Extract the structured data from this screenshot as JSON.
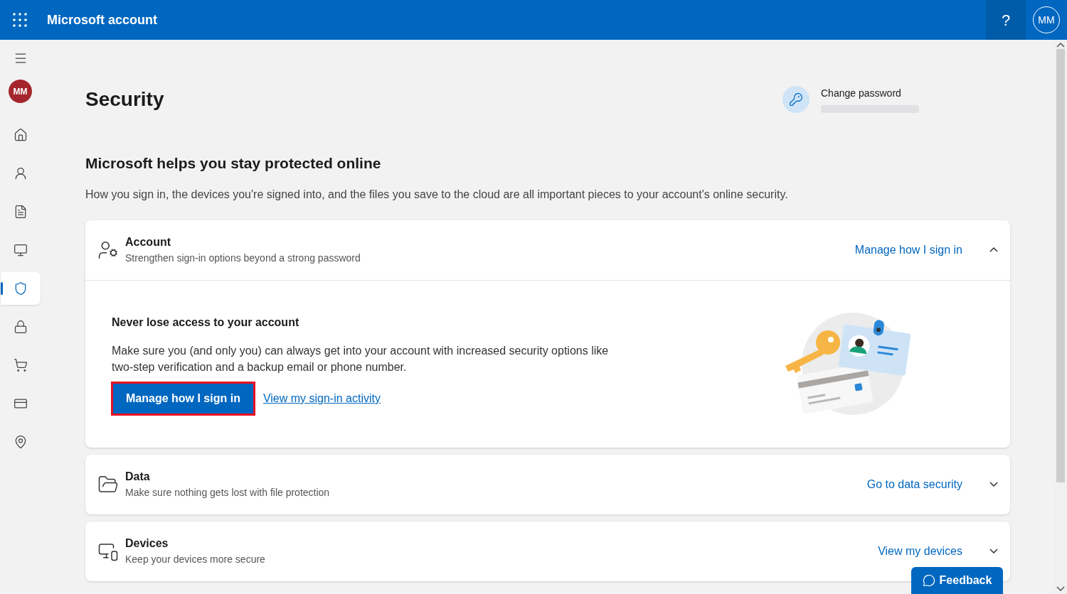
{
  "header": {
    "title": "Microsoft account",
    "help": "?",
    "avatar": "MM"
  },
  "sidebar": {
    "avatar": "MM",
    "items": [
      {
        "selected": false
      },
      {
        "selected": false
      },
      {
        "selected": false
      },
      {
        "selected": false
      },
      {
        "selected": true
      },
      {
        "selected": false
      },
      {
        "selected": false
      },
      {
        "selected": false
      },
      {
        "selected": false
      }
    ]
  },
  "page": {
    "title": "Security",
    "change_password": "Change password",
    "heading": "Microsoft helps you stay protected online",
    "description": "How you sign in, the devices you're signed into, and the files you save to the cloud are all important pieces to your account's online security."
  },
  "sections": [
    {
      "title": "Account",
      "subtitle": "Strengthen sign-in options beyond a strong password",
      "link": "Manage how I sign in",
      "expanded": true,
      "body": {
        "title": "Never lose access to your account",
        "text": "Make sure you (and only you) can always get into your account with increased security options like two-step verification and a backup email or phone number.",
        "button": "Manage how I sign in",
        "button_highlighted": true,
        "link": "View my sign-in activity"
      }
    },
    {
      "title": "Data",
      "subtitle": "Make sure nothing gets lost with file protection",
      "link": "Go to data security",
      "expanded": false
    },
    {
      "title": "Devices",
      "subtitle": "Keep your devices more secure",
      "link": "View my devices",
      "expanded": false
    }
  ],
  "feedback": "Feedback"
}
